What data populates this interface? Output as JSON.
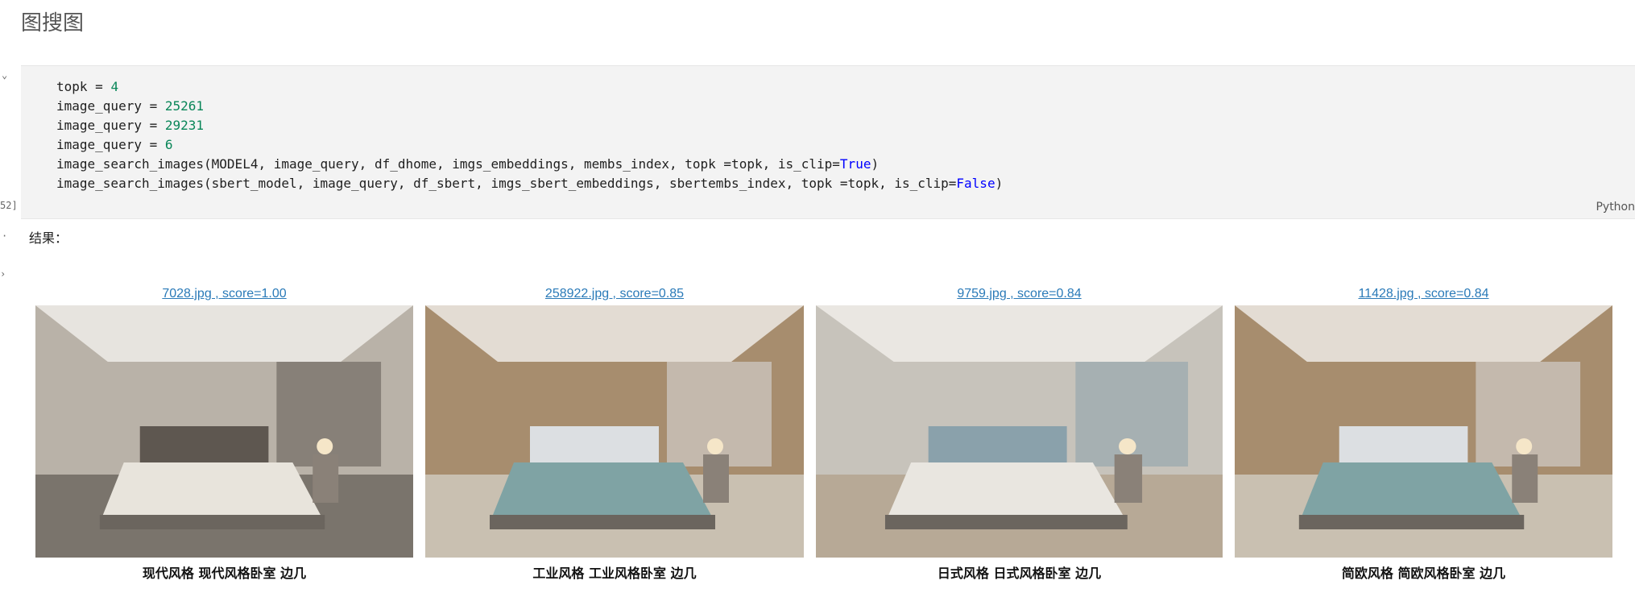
{
  "heading": "图搜图",
  "cell": {
    "collapse_glyph": "⌄",
    "run_count": "52]",
    "language": "Python",
    "lines": [
      [
        {
          "t": "topk = "
        },
        {
          "t": "4",
          "c": "num"
        }
      ],
      [
        {
          "t": "image_query = "
        },
        {
          "t": "25261",
          "c": "num"
        }
      ],
      [
        {
          "t": "image_query = "
        },
        {
          "t": "29231",
          "c": "num"
        }
      ],
      [
        {
          "t": "image_query = "
        },
        {
          "t": "6",
          "c": "num"
        }
      ],
      [
        {
          "t": "image_search_images(MODEL4, image_query, df_dhome, imgs_embeddings, membs_index, topk =topk, is_clip="
        },
        {
          "t": "True",
          "c": "kw"
        },
        {
          "t": ")"
        }
      ],
      [
        {
          "t": "image_search_images(sbert_model, image_query, df_sbert, imgs_sbert_embeddings, sbertembs_index, topk =topk, is_clip="
        },
        {
          "t": "False",
          "c": "kw"
        },
        {
          "t": ")"
        }
      ]
    ]
  },
  "output": {
    "label": "结果：",
    "results": [
      {
        "link": "7028.jpg , score=1.00",
        "caption": "现代风格 现代风格卧室 边几",
        "palette": {
          "wall": "#b9b2a8",
          "floor": "#7a746c",
          "bed": "#e8e4dc",
          "accent": "#5e5750"
        }
      },
      {
        "link": "258922.jpg , score=0.85",
        "caption": "工业风格 工业风格卧室 边几",
        "palette": {
          "wall": "#a78d6e",
          "floor": "#c9c0b1",
          "bed": "#7fa3a4",
          "accent": "#dcdfe2"
        }
      },
      {
        "link": "9759.jpg , score=0.84",
        "caption": "日式风格 日式风格卧室 边几",
        "palette": {
          "wall": "#c7c3bb",
          "floor": "#b7a996",
          "bed": "#e9e6e0",
          "accent": "#8aa1ab"
        }
      },
      {
        "link": "11428.jpg , score=0.84",
        "caption": "简欧风格 简欧风格卧室 边几",
        "palette": {
          "wall": "#a78d6e",
          "floor": "#c9c0b1",
          "bed": "#7fa3a4",
          "accent": "#dcdfe2"
        }
      }
    ]
  }
}
